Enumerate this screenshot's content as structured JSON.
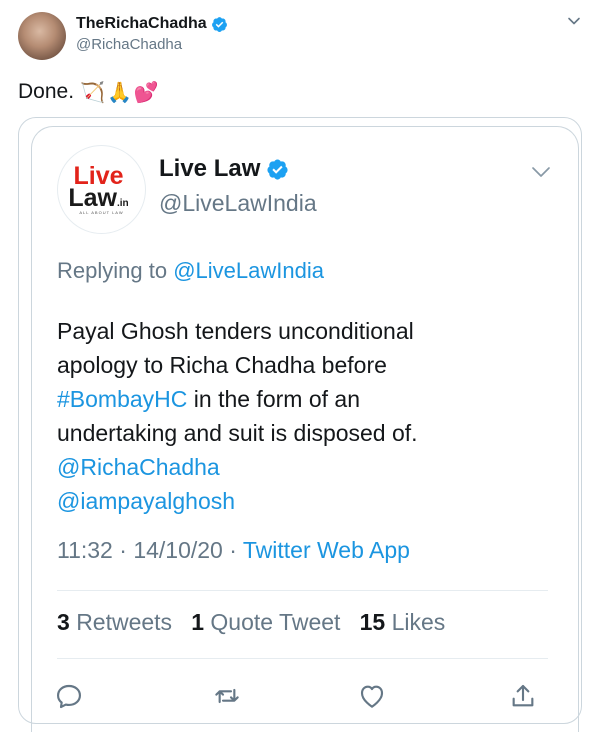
{
  "outer": {
    "display_name": "TheRichaChadha",
    "handle": "@RichaChadha",
    "text": "Done.",
    "emojis": [
      "🏹",
      "🙏",
      "💕"
    ]
  },
  "quoted": {
    "logo_line1": "Live",
    "logo_line2": "Law",
    "logo_suffix": ".in",
    "logo_tagline": "ALL ABOUT LAW",
    "display_name": "Live Law",
    "handle": "@LiveLawIndia",
    "replying_prefix": "Replying to",
    "replying_to": "@LiveLawIndia",
    "body": {
      "line1": "Payal Ghosh tenders unconditional",
      "line2": "apology to Richa Chadha before",
      "hashtag": "#BombayHC",
      "line3_rest": " in the form of an",
      "line4": "undertaking and suit is disposed of.",
      "mention1": "@RichaChadha",
      "mention2": "@iampayalghosh"
    },
    "time": "11:32",
    "date": "14/10/20",
    "source": "Twitter Web App",
    "stats": {
      "retweets_count": "3",
      "retweets_label": "Retweets",
      "quotes_count": "1",
      "quotes_label": "Quote Tweet",
      "likes_count": "15",
      "likes_label": "Likes"
    }
  },
  "colors": {
    "link": "#1b95e0",
    "muted": "#657786",
    "verified": "#1da1f2",
    "logo_red": "#e2231a"
  }
}
